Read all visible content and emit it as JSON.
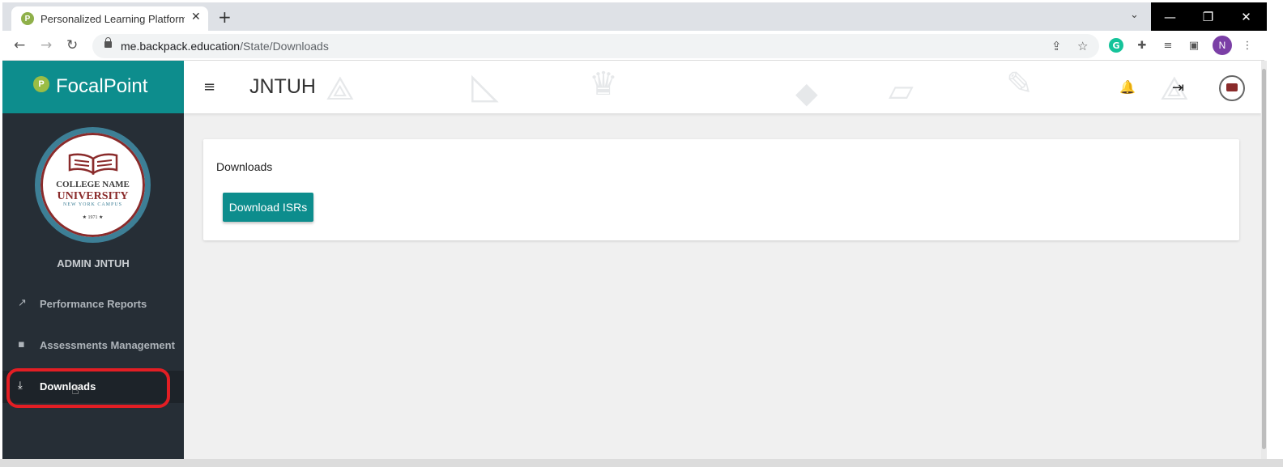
{
  "browser": {
    "tab_title": "Personalized Learning Platform |",
    "tab_close": "✕",
    "new_tab": "+",
    "tab_search": "⌄",
    "url_host": "me.backpack.education",
    "url_path": "/State/Downloads",
    "back": "←",
    "forward": "→",
    "reload": "↻",
    "share_icon": "⇪",
    "star_icon": "☆",
    "grammarly_icon": "G",
    "extensions_icon": "✚",
    "media_icon": "≡",
    "sidepanel_icon": "▣",
    "profile_initial": "N",
    "menu_icon": "⋮",
    "minimize": "—",
    "restore": "❐",
    "close": "✕"
  },
  "app": {
    "brand": "FocalPoint",
    "brand_icon": "P",
    "menu_icon": "≡",
    "page_title": "JNTUH",
    "bell_icon": "🔔",
    "logout_icon": "⇥",
    "university": {
      "line1": "COLLEGE NAME",
      "line2": "UNIVERSITY",
      "line3": "NEW YORK CAMPUS",
      "line4": "★ 1971 ★"
    },
    "admin_name": "ADMIN JNTUH",
    "nav": [
      {
        "label": "Performance Reports",
        "icon": "trending-up-icon",
        "glyph": "↗",
        "active": false
      },
      {
        "label": "Assessments Management",
        "icon": "chart-box-icon",
        "glyph": "▪",
        "active": false
      },
      {
        "label": "Downloads",
        "icon": "download-icon",
        "glyph": "⤓",
        "active": true
      }
    ],
    "cursor": "☝",
    "card": {
      "title": "Downloads",
      "button_label": "Download ISRs"
    }
  },
  "colors": {
    "teal": "#0d8d8d",
    "sidebar": "#262e36",
    "highlight": "#e31e24"
  }
}
